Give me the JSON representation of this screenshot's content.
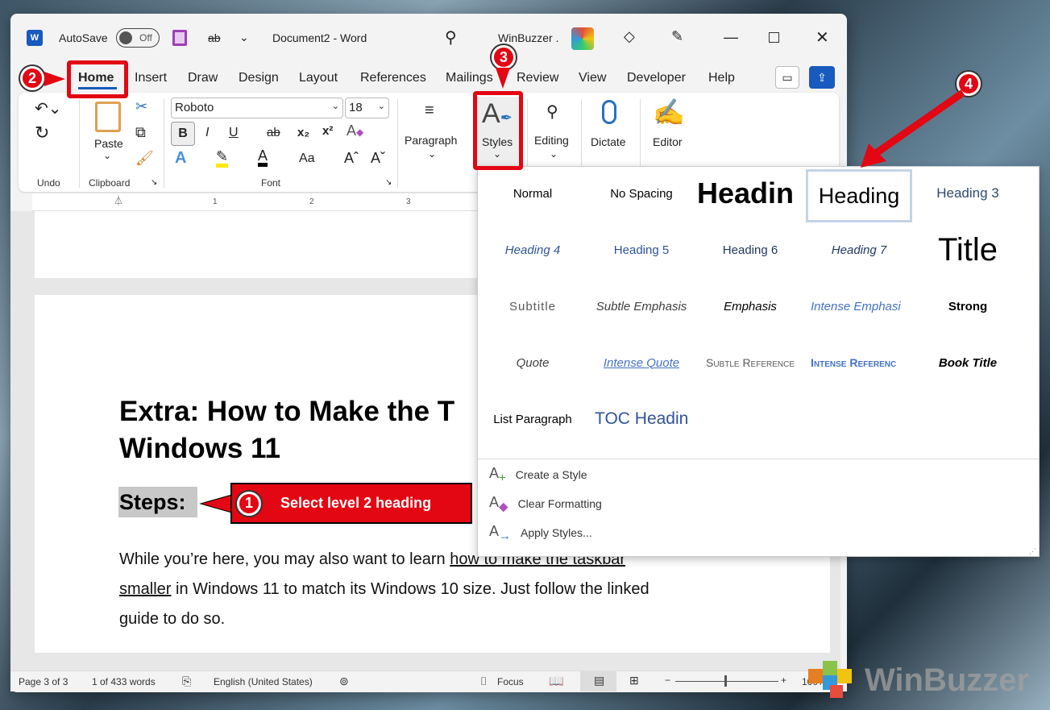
{
  "titlebar": {
    "autosave_label": "AutoSave",
    "autosave_state": "Off",
    "doc_title": "Document2  -  Word",
    "account": "WinBuzzer ."
  },
  "tabs": [
    "Home",
    "Insert",
    "Draw",
    "Design",
    "Layout",
    "References",
    "Mailings",
    "Review",
    "View",
    "Developer",
    "Help"
  ],
  "ribbon": {
    "undo_group": "Undo",
    "paste": "Paste",
    "clipboard_group": "Clipboard",
    "font_name": "Roboto",
    "font_size": "18",
    "font_group": "Font",
    "paragraph": "Paragraph",
    "styles": "Styles",
    "editing": "Editing",
    "dictate": "Dictate",
    "editor": "Editor",
    "bold": "B",
    "italic": "I",
    "underline": "U",
    "subscript": "x₂",
    "superscript": "x²",
    "change_case": "Aa"
  },
  "ruler_ticks": [
    "1",
    "2",
    "3"
  ],
  "document": {
    "heading1": "Extra: How to Make the T",
    "heading1_line2": "Windows 11",
    "heading2": "Steps:",
    "para_before": "While you’re here, you may also want to learn ",
    "link1": "how to make the taskbar",
    "link2": "smaller",
    "para_after": " in Windows 11 to match its Windows 10 size. Just follow the linked",
    "para_line3": "guide to do so."
  },
  "styles_gallery": {
    "items": [
      "Normal",
      "No Spacing",
      "Headin",
      "Heading",
      "Heading 3",
      "Heading 4",
      "Heading 5",
      "Heading 6",
      "Heading 7",
      "Title",
      "Subtitle",
      "Subtle Emphasis",
      "Emphasis",
      "Intense Emphasi",
      "Strong",
      "Quote",
      "Intense Quote",
      "Subtle Reference",
      "Intense Referenc",
      "Book Title",
      "List Paragraph",
      "TOC Headin"
    ],
    "menu": [
      "Create a Style",
      "Clear Formatting",
      "Apply Styles..."
    ]
  },
  "annotations": {
    "step1": "1",
    "step1_label": "Select level 2 heading",
    "step2": "2",
    "step3": "3",
    "step4": "4"
  },
  "status": {
    "page": "Page 3 of 3",
    "words": "1 of 433 words",
    "language": "English (United States)",
    "focus": "Focus",
    "zoom": "100%"
  },
  "watermark": "WinBuzzer",
  "colors": {
    "accent": "#185abd",
    "annotation_red": "#e30613",
    "heading_blue": "#2f5496"
  }
}
